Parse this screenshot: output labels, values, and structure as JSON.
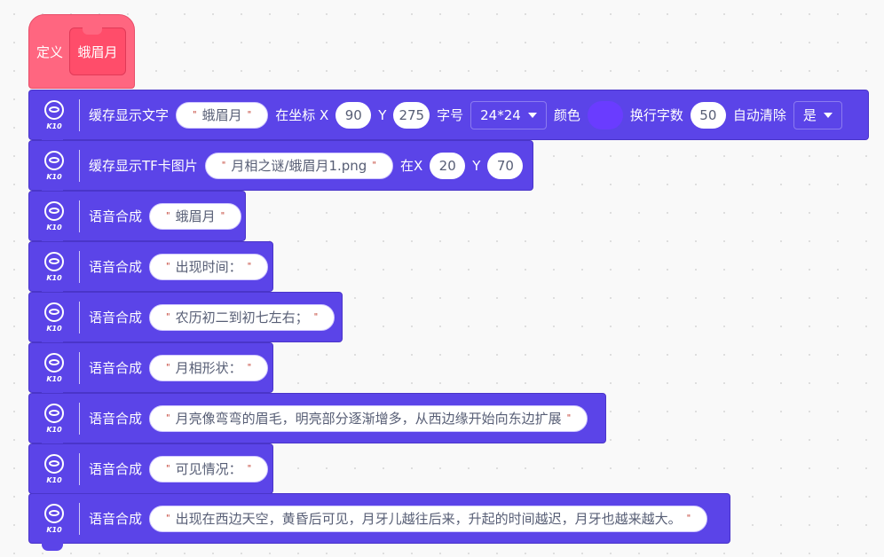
{
  "define": {
    "label": "定义",
    "proc_name": "蛾眉月"
  },
  "k10_label": "K10",
  "display_text": {
    "label": "缓存显示文字",
    "text": "蛾眉月",
    "at_x_label": "在坐标 X",
    "x": "90",
    "y_label": "Y",
    "y": "275",
    "font_label": "字号",
    "font": "24*24",
    "color_label": "颜色",
    "color": "#6a3cff",
    "wrap_label": "换行字数",
    "wrap": "50",
    "autoclear_label": "自动清除",
    "autoclear": "是"
  },
  "display_image": {
    "label": "缓存显示TF卡图片",
    "path": "月相之谜/蛾眉月1.png",
    "x_label": "在X",
    "x": "20",
    "y_label": "Y",
    "y": "70"
  },
  "speech_label": "语音合成",
  "speech": [
    "蛾眉月",
    "出现时间：",
    "农历初二到初七左右；",
    "月相形状：",
    "月亮像弯弯的眉毛，明亮部分逐渐增多，从西边缘开始向东边扩展",
    "可见情况：",
    "出现在西边天空，黄昏后可见，月牙儿越往后来，升起的时间越迟，月牙也越来越大。"
  ]
}
